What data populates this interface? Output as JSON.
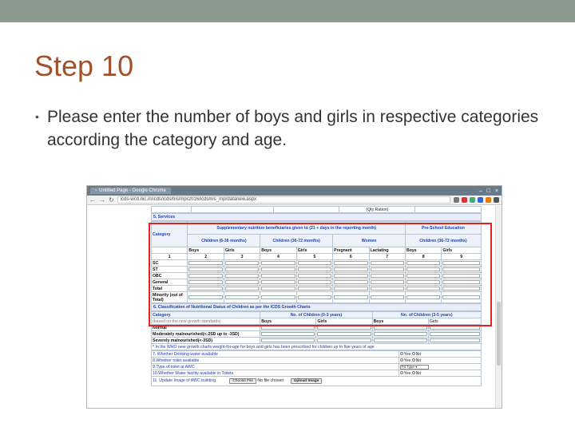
{
  "slide": {
    "title": "Step 10",
    "bullet": "Please enter the number of boys and girls in respective categories according the category and age."
  },
  "browser": {
    "tab_title": "Untitled Page - Google Chrome",
    "url": "icds-wcd.nic.in/icds/icdsmis/mpr2016/icdsmis_mprdatanew.aspx"
  },
  "form": {
    "top_fragment": "(Qty Ration)",
    "section5": "5. Services",
    "table5": {
      "head_main": "Supplementary nutrition beneficiaries given to (21 + days in the reporting month)",
      "head_pse": "Pre-School Education",
      "category": "Category",
      "children_6_36": "Children (6-36 months)",
      "children_36_72": "Children (36-72 months)",
      "women": "Women",
      "children_36_72_pse": "Children (36-72 months)",
      "sub": [
        "Boys",
        "Girls",
        "Boys",
        "Girls",
        "Pregnant",
        "Lactating",
        "Boys",
        "Girls"
      ],
      "col_nums": [
        "1",
        "2",
        "3",
        "4",
        "5",
        "6",
        "7",
        "8",
        "9"
      ],
      "rows": [
        "SC",
        "ST",
        "OBC",
        "General",
        "Total",
        "Minority (out of Total)"
      ]
    },
    "section6": "6. Classification of Nutritional Status of Children as per the ICDS Growth Charts",
    "table6": {
      "category": "Category",
      "category_sub": "(based on the new growth standards)",
      "children_0_3": "No. of Children (0-3 years)",
      "children_3_5": "No. of Children (3-5 years)",
      "sub": [
        "Boys",
        "Girls",
        "Boys",
        "Girls"
      ],
      "rows": [
        "Normal",
        "Moderately malnourished(<-2SD up to -3SD)",
        "Severely malnourished(<-3SD)"
      ],
      "note": "* In the WHO new growth charts,weight-for-age for boys and girls has been prescribed for children up to five years of age"
    },
    "questions": [
      {
        "label": "7. Whether Drinking water available",
        "yes": "Yes",
        "no": "No"
      },
      {
        "label": "8.Whether toilet available",
        "yes": "Yes",
        "no": "No"
      },
      {
        "label": "9.Type of toilet at AWC",
        "select": "Pit Type"
      },
      {
        "label": "10.Whether Water facility available in Toilets",
        "yes": "Yes",
        "no": "No"
      }
    ],
    "upload": {
      "num": "11",
      "label": "Update Image of AWC building",
      "choose": "Choose File",
      "no_file": "No file chosen",
      "upload_btn": "Upload Image"
    }
  },
  "colors": {
    "title": "#a0522d",
    "highlight": "#e52222",
    "topbar": "#8a9a8c"
  }
}
